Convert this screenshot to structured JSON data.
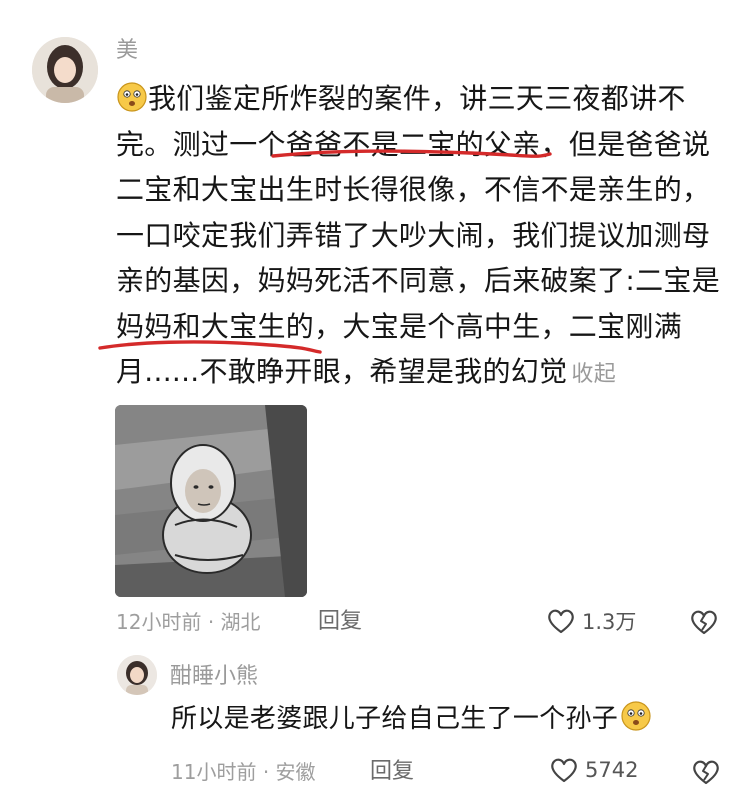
{
  "comment": {
    "username": "美",
    "body_lines": [
      "我们鉴定所炸裂的案件，讲三天三夜都讲不",
      "完。测过一个爸爸不是二宝的父亲，但是爸爸说",
      "二宝和大宝出生时长得很像，不信不是亲生的，",
      "一口咬定我们弄错了大吵大闹，我们提议加测母",
      "亲的基因，妈妈死活不同意，后来破案了:二宝是",
      "妈妈和大宝生的，大宝是个高中生，二宝刚满",
      "月......不敢睁开眼，希望是我的幻觉"
    ],
    "collapse_label": "收起",
    "time": "12小时前",
    "location": "湖北",
    "separator": "·",
    "reply_label": "回复",
    "likes": "1.3万"
  },
  "reply": {
    "username": "酣睡小熊",
    "body": "所以是老婆跟儿子给自己生了一个孙子",
    "time": "11小时前",
    "location": "安徽",
    "separator": "·",
    "reply_label": "回复",
    "likes": "5742"
  },
  "colors": {
    "underline": "#d42a2a",
    "meta_text": "#9e9e9e",
    "username": "#9a9a9a"
  },
  "icons": [
    "face-emoji-icon",
    "heart-outline-icon",
    "broken-heart-icon"
  ]
}
